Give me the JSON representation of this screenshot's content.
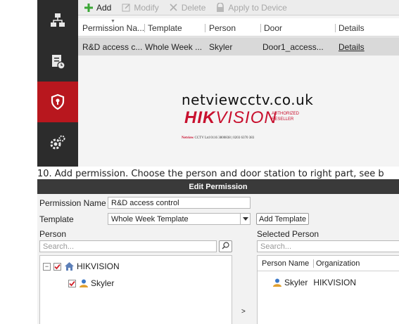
{
  "toolbar": {
    "add": "Add",
    "modify": "Modify",
    "delete": "Delete",
    "apply": "Apply to Device"
  },
  "table": {
    "columns": [
      "Permission Na...",
      "Template",
      "Person",
      "Door",
      "Details"
    ],
    "rows": [
      [
        "R&D access c...",
        "Whole Week ...",
        "Skyler",
        "Door1_access...",
        "Details"
      ]
    ]
  },
  "watermark": {
    "site": "netviewcctv.co.uk",
    "brand_a": "HIK",
    "brand_b": "VISION",
    "authorized": "AUTHORIZED",
    "reseller": "RESELLER",
    "company": "Netview",
    "contact": "CCTV Ltd 0116 3800838 | 0203 6370 383"
  },
  "instruction": "10. Add permission. Choose the person and door station to right part, see b",
  "dialog": {
    "title": "Edit Permission",
    "permission_name_label": "Permission Name",
    "permission_name_value": "R&D access control",
    "template_label": "Template",
    "template_value": "Whole Week Template",
    "add_template": "Add Template",
    "person_label": "Person",
    "selected_person_label": "Selected Person",
    "search_placeholder": "Search...",
    "selected_search_placeholder": "Search...",
    "tree": {
      "org": "HIKVISION",
      "person": "Skyler"
    },
    "selected_columns": [
      "Person Name",
      "Organization"
    ],
    "selected_rows": [
      [
        "Skyler",
        "HIKVISION"
      ]
    ],
    "move_arrow": ">"
  },
  "colors": {
    "accent_red": "#b8171e",
    "sidebar_bg": "#2c2c2c",
    "add_green": "#3aa635",
    "check_red": "#d0202a"
  },
  "icons": {
    "sidebar": [
      "organization-icon",
      "access-record-icon",
      "access-control-icon",
      "settings-icon"
    ],
    "toolbar": [
      "add-icon",
      "modify-icon",
      "delete-icon",
      "apply-device-icon"
    ]
  }
}
